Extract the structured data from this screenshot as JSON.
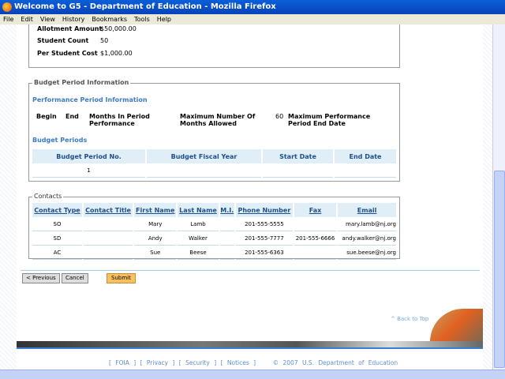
{
  "window": {
    "title": "Welcome to G5 - Department of Education - Mozilla Firefox"
  },
  "menu": [
    "File",
    "Edit",
    "View",
    "History",
    "Bookmarks",
    "Tools",
    "Help"
  ],
  "summary": [
    {
      "label": "Allotment Amount",
      "value": "$50,000.00"
    },
    {
      "label": "Student Count",
      "value": "50"
    },
    {
      "label": "Per Student Cost",
      "value": "$1,000.00"
    }
  ],
  "budget": {
    "legend": "Budget Period Information",
    "perf_title": "Performance Period Information",
    "fields": {
      "begin": "Begin",
      "end": "End",
      "months": "Months In Period Performance",
      "max_months": "Maximum Number Of Months Allowed",
      "max_months_value": "60",
      "max_end": "Maximum Performance Period End Date"
    },
    "periods_title": "Budget Periods",
    "headers": [
      "Budget Period No.",
      "Budget Fiscal Year",
      "Start Date",
      "End Date"
    ],
    "rows": [
      [
        "1",
        "",
        "",
        ""
      ]
    ]
  },
  "contacts": {
    "legend": "Contacts",
    "headers": [
      "Contact Type",
      "Contact Title",
      "First Name",
      "Last Name",
      "M.I.",
      "Phone Number",
      "Fax",
      "Email"
    ],
    "rows": [
      [
        "SO",
        "",
        "Mary",
        "Lamb",
        "",
        "201-555-5555",
        "",
        "mary.lamb@nj.org"
      ],
      [
        "SD",
        "",
        "Andy",
        "Walker",
        "",
        "201-555-7777",
        "201-555-6666",
        "andy.walker@nj.org"
      ],
      [
        "AC",
        "",
        "Sue",
        "Beese",
        "",
        "201-555-6363",
        "",
        "sue.beese@nj.org"
      ]
    ]
  },
  "buttons": {
    "previous": "< Previous",
    "cancel": "Cancel",
    "submit": "Submit"
  },
  "back_to_top": "^ Back to Top",
  "footer": {
    "links": [
      "FOIA",
      "Privacy",
      "Security",
      "Notices"
    ],
    "copyright": "© 2007 U.S. Department of Education"
  }
}
